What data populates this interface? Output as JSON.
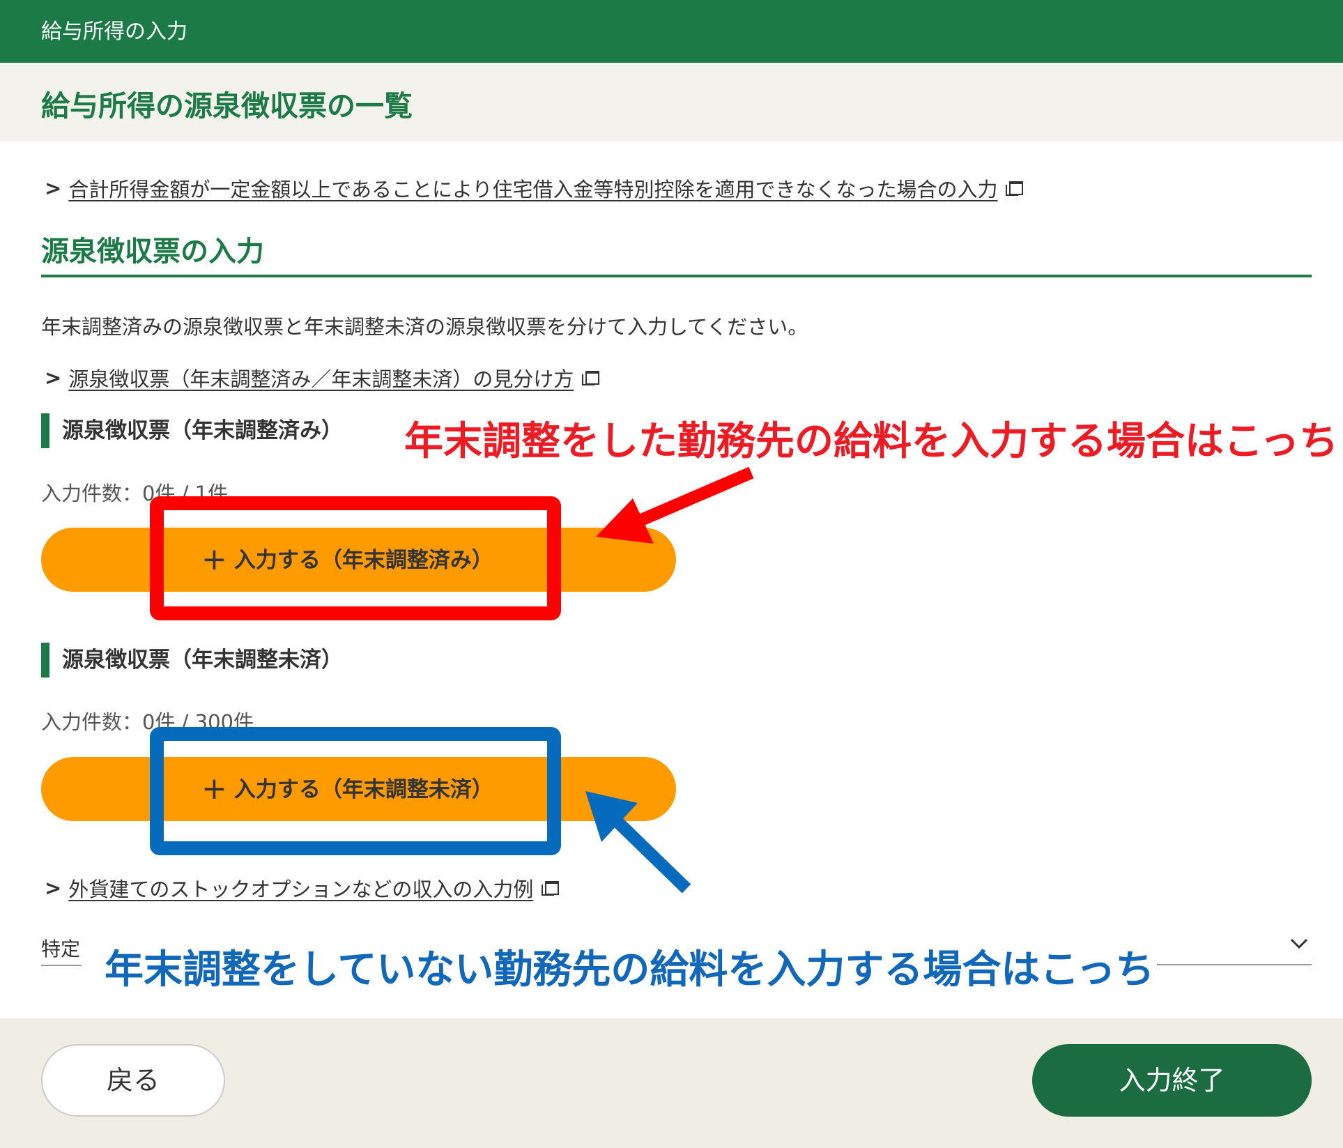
{
  "header": {
    "title": "給与所得の入力"
  },
  "page": {
    "title": "給与所得の源泉徴収票の一覧"
  },
  "links": {
    "housing_loan": "合計所得金額が一定金額以上であることにより住宅借入金等特別控除を適用できなくなった場合の入力",
    "how_to_tell": "源泉徴収票（年末調整済み／年末調整未済）の見分け方",
    "stock_option": "外貨建てのストックオプションなどの収入の入力例"
  },
  "section": {
    "heading": "源泉徴収票の入力",
    "description": "年末調整済みの源泉徴収票と年末調整未済の源泉徴収票を分けて入力してください。"
  },
  "adjusted": {
    "heading": "源泉徴収票（年末調整済み）",
    "count": "入力件数：0件 / 1件",
    "button": "入力する（年末調整済み）"
  },
  "unadjusted": {
    "heading": "源泉徴収票（年末調整未済）",
    "count": "入力件数：0件 / 300件",
    "button": "入力する（年末調整未済）"
  },
  "specific": {
    "label": "特定"
  },
  "annotations": {
    "red": "年末調整をした勤務先の給料を入力する場合はこっち",
    "blue": "年末調整をしていない勤務先の給料を入力する場合はこっち"
  },
  "footer": {
    "back": "戻る",
    "finish": "入力終了"
  },
  "icons": {
    "chevron": "chevron-right-icon",
    "external": "external-window-icon",
    "plus": "plus-icon",
    "dropdown": "chevron-down-icon"
  },
  "colors": {
    "brand_green": "#1b7a46",
    "button_orange": "#fe9b00",
    "annotation_red": "#ed1c24",
    "annotation_blue": "#1167b9"
  }
}
